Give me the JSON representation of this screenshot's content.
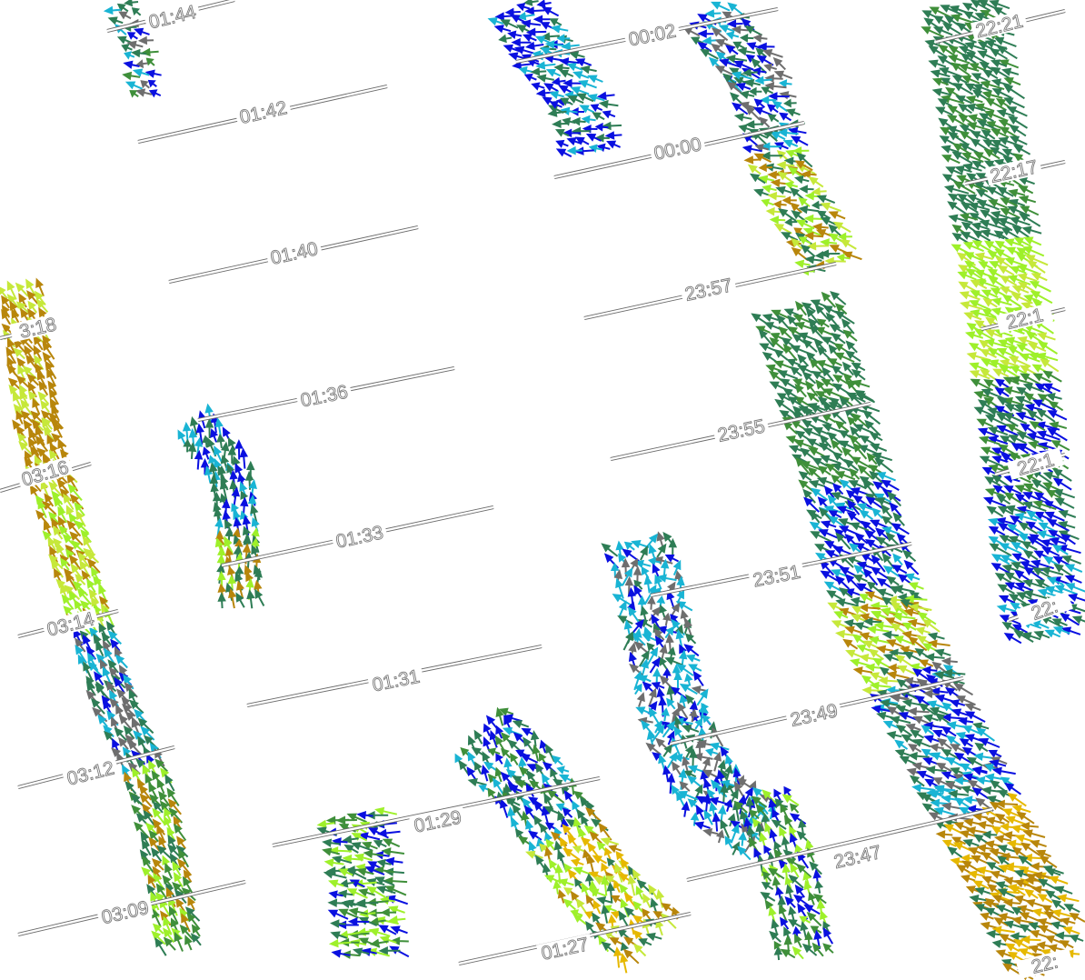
{
  "map": {
    "title": "",
    "colors": {
      "background": "#ffffff",
      "track": "#6a6a6a",
      "label_fill": "#ffffff",
      "label_stroke": "#7a7a7a",
      "vector_palette": [
        "#0a10e0",
        "#19b4d4",
        "#2e7d55",
        "#3f8f3a",
        "#9ef02a",
        "#c6e83a",
        "#b8860b",
        "#e6b800",
        "#6e6e6e"
      ]
    },
    "tracks": [
      {
        "label": "01:44"
      },
      {
        "label": "01:42"
      },
      {
        "label": "01:40"
      },
      {
        "label": "01:36"
      },
      {
        "label": "01:33"
      },
      {
        "label": "01:31"
      },
      {
        "label": "01:29"
      },
      {
        "label": "01:27"
      },
      {
        "label": "00:02"
      },
      {
        "label": "00:00"
      },
      {
        "label": "23:57"
      },
      {
        "label": "23:55"
      },
      {
        "label": "23:51"
      },
      {
        "label": "23:49"
      },
      {
        "label": "23:47"
      },
      {
        "label": "22:21"
      },
      {
        "label": "22:17"
      },
      {
        "label": "22:1"
      },
      {
        "label": "22:1"
      },
      {
        "label": "22:"
      },
      {
        "label": "22:"
      },
      {
        "label": "3:18"
      },
      {
        "label": "03:16"
      },
      {
        "label": "03:14"
      },
      {
        "label": "03:12"
      },
      {
        "label": "03:09"
      }
    ]
  }
}
